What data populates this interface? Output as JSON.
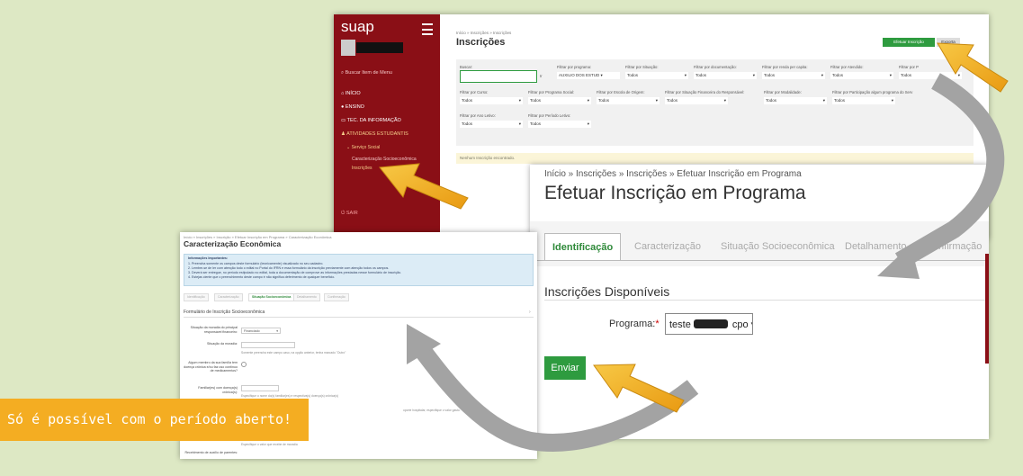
{
  "suap": {
    "logo": "suap",
    "search": "Buscar Item de Menu",
    "menu": [
      "INÍCIO",
      "ENSINO",
      "TEC. DA INFORMAÇÃO",
      "ATIVIDADES ESTUDANTIS"
    ],
    "submenu": "Serviço Social",
    "subitems": [
      "Caracterização Socioeconômica",
      "Inscrições"
    ],
    "logout": "SAIR",
    "breadcrumb": "Início » Inscrições » Inscrições",
    "title": "Inscrições",
    "btn_efetuar": "Efetuar Inscrição",
    "btn_export": "Exporta",
    "filters": {
      "buscar": "Buscar:",
      "ir": "Ir",
      "row1": [
        {
          "label": "Filtrar por programa:",
          "value": "AUXILIO DOS ESTUD"
        },
        {
          "label": "Filtrar por Situação:",
          "value": "Todos"
        },
        {
          "label": "Filtrar por documentação:",
          "value": "Todos"
        },
        {
          "label": "Filtrar por renda per capita:",
          "value": "Todos"
        },
        {
          "label": "Filtrar por Atendido:",
          "value": "Todos"
        },
        {
          "label": "Filtrar por P",
          "value": "Todos"
        }
      ],
      "row2": [
        {
          "label": "Filtrar por Curso:",
          "value": "Todos"
        },
        {
          "label": "Filtrar por Programa Social:",
          "value": "Todos"
        },
        {
          "label": "Filtrar por Escola de Origem:",
          "value": "Todos"
        },
        {
          "label": "Filtrar por Situação Financeira do Responsável:",
          "value": "Todos"
        },
        {
          "label": "Filtrar por Modalidade:",
          "value": "Todos"
        },
        {
          "label": "Filtrar por Participação algum programa do Serv",
          "value": "Todos"
        }
      ],
      "row3": [
        {
          "label": "Filtrar por Ano Letivo:",
          "value": "Todos"
        },
        {
          "label": "Filtrar por Período Letivo:",
          "value": "Todos"
        }
      ]
    },
    "empty": "Nenhum Inscrição encontrado."
  },
  "efetuar": {
    "breadcrumb": "Início » Inscrições » Inscrições » Efetuar Inscrição em Programa",
    "title": "Efetuar Inscrição em Programa",
    "tabs": [
      "Identificação",
      "Caracterização",
      "Situação Socioeconômica",
      "Detalhamento",
      "Confirmação"
    ],
    "section": "Inscrições Disponíveis",
    "program_label": "Programa:",
    "required_mark": "*",
    "program_value": "teste",
    "program_suffix": "cpo",
    "submit": "Enviar"
  },
  "carac": {
    "breadcrumb": "Início » Inscrições » Inscrição » Efetuar Inscrição em Programa » Caracterização Econômica",
    "title": "Caracterização Econômica",
    "info_title": "Informações Importantes:",
    "info_lines": [
      "1. Preencha somente os campos deste formulário (tecnicamente) visualizado no seu cadastro.",
      "2. Lembre-se de ler com atenção todo o edital no Portal do IFRN e essa formulário da inscrição previamente com atenção todos os campos.",
      "3. Deverá ser entregue, no período estipulado no edital, toda a documentação de comprove as informações prestadas nesse formulário de inscrição.",
      "4. Estejas ciente que o preenchimento deste campo é não significa deferimento de qualquer benefício."
    ],
    "tabs": [
      "Identificação",
      "Caracterização",
      "Situação Socioeconômica",
      "Detalhamento",
      "Confirmação"
    ],
    "form_title": "Formulário de Inscrição Socioeconômica",
    "rows": [
      {
        "label": "Situação da moradia do principal responsável financeiro:",
        "value": "Financiado",
        "hint": ""
      },
      {
        "label": "Situação da moradia:",
        "value": "",
        "hint": "Somente preencha este campo caso, na opção anterior, tenha marcado \"Outro\""
      },
      {
        "label": "Algum membro da sua família tem doença crônica e/ou faz uso contínuo de medicamentos?",
        "value": "",
        "hint": ""
      },
      {
        "label": "Familiar(es) com doença(s) crônica(s):",
        "value": "",
        "hint": "Especifique o nome do(s) familiar(es) e respectiva(s) doença(s) crônica(s)"
      },
      {
        "label": "",
        "value": "",
        "hint": "oporte hospitalar, especifique o valor gasto."
      },
      {
        "label": "",
        "value": "",
        "hint": "Especifique o valor que recebe de moradia"
      },
      {
        "label": "Recebimento de auxílio de parentes:",
        "value": "",
        "hint": ""
      }
    ]
  },
  "banner": "Só é possível com o período aberto!",
  "colors": {
    "suap_red": "#8a0f16",
    "suap_green": "#2e9b3f",
    "arrow": "#f4ad22",
    "background": "#dde8c4"
  }
}
